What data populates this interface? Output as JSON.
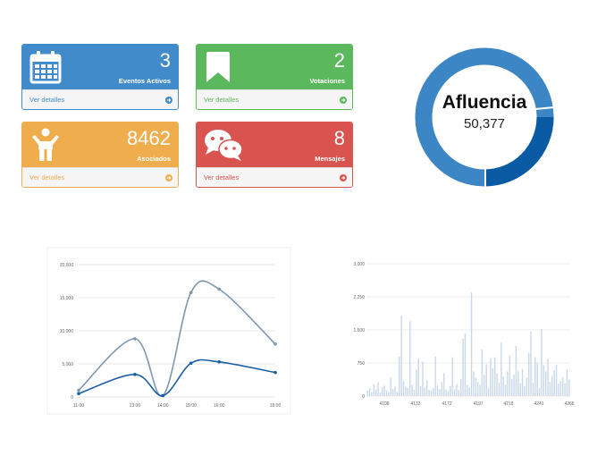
{
  "cards": [
    {
      "value": "3",
      "label": "Eventos Activos",
      "link": "Ver detalles",
      "icon": "calendar-icon",
      "color": "#428bca"
    },
    {
      "value": "2",
      "label": "Votaciones",
      "link": "Ver detalles",
      "icon": "bookmark-icon",
      "color": "#5cb85c"
    },
    {
      "value": "8462",
      "label": "Asociados",
      "link": "Ver detalles",
      "icon": "person-icon",
      "color": "#f0ad4e"
    },
    {
      "value": "8",
      "label": "Mensajes",
      "link": "Ver detalles",
      "icon": "chat-icon",
      "color": "#d9534f"
    }
  ],
  "donut": {
    "title": "Afluencia",
    "value": "50,377"
  },
  "chart_data": [
    {
      "type": "line",
      "categories": [
        "11:00",
        "13:00",
        "14:00",
        "15:00",
        "16:00",
        "18:00"
      ],
      "x": [
        11,
        13,
        14,
        15,
        16,
        18
      ],
      "series": [
        {
          "values": [
            1000,
            8800,
            200,
            15800,
            16300,
            8000
          ],
          "color": "#7f96b0"
        },
        {
          "values": [
            500,
            3400,
            200,
            5100,
            5300,
            3700
          ],
          "color": "#1a5fa3"
        }
      ],
      "yticks": [
        "0",
        "5,000",
        "10,000",
        "15,000",
        "20,000"
      ],
      "ylim": [
        0,
        20000
      ],
      "grid": true
    },
    {
      "type": "bar",
      "xticks": [
        "4108",
        "4133",
        "4172",
        "4197",
        "4218",
        "4241",
        "4268"
      ],
      "yticks": [
        "0",
        "750",
        "1,500",
        "2,250",
        "3,000"
      ],
      "ylim": [
        0,
        3000
      ],
      "color": "#c9d9ea",
      "values": [
        120,
        180,
        90,
        260,
        150,
        310,
        80,
        200,
        240,
        130,
        90,
        420,
        160,
        220,
        100,
        900,
        1820,
        340,
        210,
        180,
        1700,
        260,
        140,
        600,
        850,
        230,
        780,
        190,
        360,
        140,
        120,
        180,
        900,
        240,
        160,
        320,
        520,
        150,
        110,
        230,
        880,
        160,
        270,
        140,
        380,
        1300,
        1420,
        260,
        190,
        2350,
        560,
        420,
        320,
        260,
        1060,
        480,
        720,
        180,
        860,
        630,
        880,
        520,
        300,
        1210,
        440,
        260,
        560,
        920,
        380,
        480,
        1140,
        560,
        290,
        620,
        220,
        420,
        980,
        1460,
        300,
        880,
        760,
        180,
        1520,
        700,
        560,
        840,
        320,
        460,
        590,
        710,
        280,
        340,
        430,
        290,
        610,
        380
      ]
    }
  ]
}
